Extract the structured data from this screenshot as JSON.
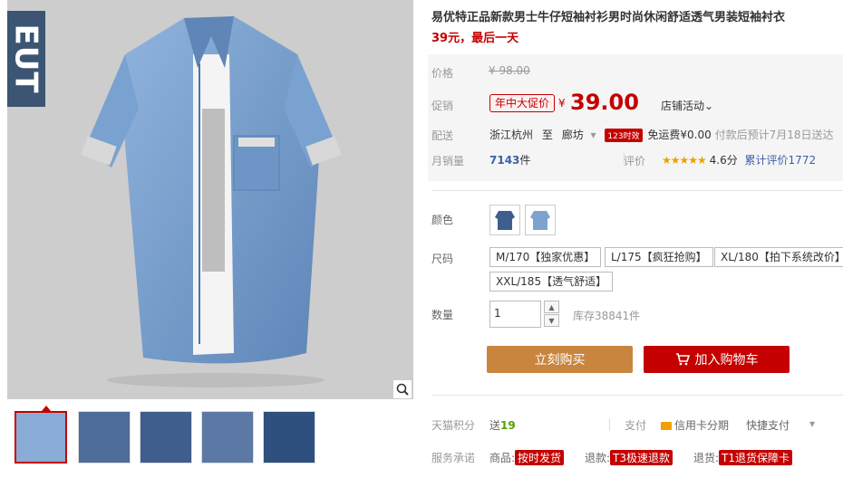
{
  "product": {
    "title": "易优特正品新款男士牛仔短袖衬衫男时尚休闲舒适透气男装短袖衬衣",
    "subtitle": "39元，最后一天",
    "brand_logo": "EUT"
  },
  "price": {
    "label": "价格",
    "original": "¥ 98.00",
    "promo_label": "促销",
    "promo_badge": "年中大促价",
    "currency": "¥",
    "current": "39.00",
    "store_activity": "店铺活动"
  },
  "shipping": {
    "label": "配送",
    "from": "浙江杭州",
    "to_word": "至",
    "dest": "廊坊",
    "badge": "123时效",
    "free": "免运费¥0.00",
    "estimate": "付款后预计7月18日送达"
  },
  "sales": {
    "label": "月销量",
    "count": "7143",
    "unit": "件",
    "review_label": "评价",
    "stars": "★★★★★",
    "score": "4.6分",
    "total_reviews": "累计评价1772"
  },
  "options": {
    "color_label": "颜色",
    "size_label": "尺码",
    "sizes": [
      "M/170【独家优惠】",
      "L/175【疯狂抢购】",
      "XL/180【拍下系统改价】",
      "XXL/185【透气舒适】"
    ],
    "qty_label": "数量",
    "qty_value": "1",
    "stock": "库存38841件"
  },
  "actions": {
    "buy_now": "立刻购买",
    "add_to_cart": "加入购物车"
  },
  "footer": {
    "points_label": "天猫积分",
    "points_prefix": "送",
    "points": "19",
    "pay_label": "支付",
    "card_pay": "信用卡分期",
    "quick_pay": "快捷支付",
    "service_label": "服务承诺",
    "goods_label": "商品:",
    "goods_tag": "按时发货",
    "refund_label": "退款:",
    "refund_tag": "T3极速退款",
    "return_label": "退货:",
    "return_tag": "T1退货保障卡"
  },
  "colors": {
    "accent": "#c40000",
    "buy_button": "#c9853e",
    "shirt": "#6a8cb8"
  }
}
